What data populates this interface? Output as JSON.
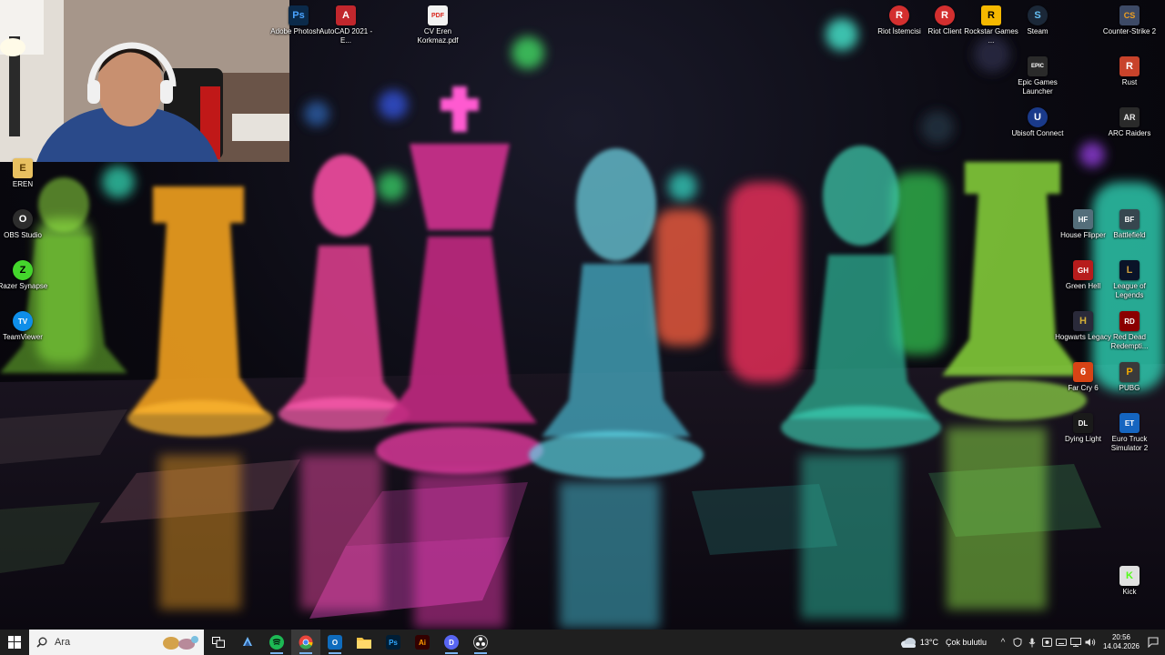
{
  "desktop": {
    "top_icons": [
      {
        "label": "Adobe Photosh...",
        "glyph": "Ps",
        "color": "#0b2a4a",
        "fg": "#4aa3ff"
      },
      {
        "label": "AutoCAD 2021 - E...",
        "glyph": "A",
        "color": "#c1272d",
        "fg": "#ffffff"
      },
      {
        "label": "CV Eren Korkmaz.pdf",
        "glyph": "PDF",
        "color": "#f2f2f2",
        "fg": "#d9261c"
      }
    ],
    "right_col1": [
      {
        "label": "Riot İstemcisi",
        "glyph": "R",
        "color": "#d32f2f",
        "fg": "#ffffff"
      },
      {
        "label": "Riot Client",
        "glyph": "R",
        "color": "#d32f2f",
        "fg": "#ffffff"
      },
      {
        "label": "Rockstar Games ...",
        "glyph": "R",
        "color": "#f5b800",
        "fg": "#000000"
      },
      {
        "label": "Steam",
        "glyph": "S",
        "color": "#1b2838",
        "fg": "#66c0f4"
      }
    ],
    "right_col2_top": [
      {
        "label": "Counter-Strike 2",
        "glyph": "CS",
        "color": "#3d4a66",
        "fg": "#f0a020"
      },
      {
        "label": "Rust",
        "glyph": "R",
        "color": "#c8432b",
        "fg": "#ffffff"
      },
      {
        "label": "ARC Raiders",
        "glyph": "AR",
        "color": "#2a2a2a",
        "fg": "#e8e8e8"
      }
    ],
    "steam_col": [
      {
        "label": "Epic Games Launcher",
        "glyph": "EPIC",
        "color": "#2a2a2a",
        "fg": "#ffffff"
      },
      {
        "label": "Ubisoft Connect",
        "glyph": "U",
        "color": "#1a3a8a",
        "fg": "#ffffff"
      }
    ],
    "left_icons": [
      {
        "label": "EREN",
        "glyph": "E",
        "color": "#e8c060",
        "fg": "#5a3a00"
      },
      {
        "label": "OBS Studio",
        "glyph": "O",
        "color": "#2d2d2d",
        "fg": "#ffffff"
      },
      {
        "label": "Razer Synapse",
        "glyph": "Z",
        "color": "#44d62c",
        "fg": "#000000"
      },
      {
        "label": "TeamViewer",
        "glyph": "TV",
        "color": "#0e8ee9",
        "fg": "#ffffff"
      }
    ],
    "games_col1": [
      {
        "label": "House Flipper",
        "glyph": "HF",
        "color": "#546e7a",
        "fg": "#ffffff"
      },
      {
        "label": "Green Hell",
        "glyph": "GH",
        "color": "#b71c1c",
        "fg": "#ffffff"
      },
      {
        "label": "Hogwarts Legacy",
        "glyph": "H",
        "color": "#2a2a3a",
        "fg": "#d4af37"
      },
      {
        "label": "Far Cry 6",
        "glyph": "6",
        "color": "#d84315",
        "fg": "#ffffff"
      },
      {
        "label": "Dying Light",
        "glyph": "DL",
        "color": "#1a1a1a",
        "fg": "#ffffff"
      }
    ],
    "games_col2": [
      {
        "label": "Battlefield",
        "glyph": "BF",
        "color": "#37474f",
        "fg": "#ffffff"
      },
      {
        "label": "League of Legends",
        "glyph": "L",
        "color": "#0a1428",
        "fg": "#c89b3c"
      },
      {
        "label": "Red Dead Redempti...",
        "glyph": "RD",
        "color": "#8b0000",
        "fg": "#ffffff"
      },
      {
        "label": "PUBG",
        "glyph": "P",
        "color": "#3a3a3a",
        "fg": "#f2a900"
      },
      {
        "label": "Euro Truck Simulator 2",
        "glyph": "ET",
        "color": "#1565c0",
        "fg": "#ffffff"
      }
    ],
    "kick": {
      "label": "Kick",
      "glyph": "K",
      "color": "#e0e0e0",
      "fg": "#53fc18"
    }
  },
  "taskbar": {
    "search_placeholder": "Ara",
    "pinned": [
      {
        "name": "task-view",
        "glyph": "▣",
        "color": "transparent",
        "fg": "#ffffff"
      },
      {
        "name": "copilot",
        "glyph": "◆",
        "color": "transparent",
        "fg": "#6fb8ff"
      },
      {
        "name": "spotify",
        "glyph": "♫",
        "color": "#1db954",
        "fg": "#000000"
      },
      {
        "name": "chrome",
        "glyph": "●",
        "color": "transparent",
        "fg": "#e8453c"
      },
      {
        "name": "outlook",
        "glyph": "O",
        "color": "#0f6cbd",
        "fg": "#ffffff"
      },
      {
        "name": "file-explorer",
        "glyph": "▬",
        "color": "transparent",
        "fg": "#f6c445"
      },
      {
        "name": "photoshop",
        "glyph": "Ps",
        "color": "#001e36",
        "fg": "#31a8ff"
      },
      {
        "name": "illustrator",
        "glyph": "Ai",
        "color": "#330000",
        "fg": "#ff9a00"
      },
      {
        "name": "discord",
        "glyph": "D",
        "color": "#5865f2",
        "fg": "#ffffff"
      },
      {
        "name": "obs",
        "glyph": "●",
        "color": "#2d2d2d",
        "fg": "#ffffff"
      }
    ],
    "weather": {
      "temp": "13°C",
      "desc": "Çok bulutlu"
    },
    "clock": {
      "time": "20:56",
      "date": "14.04.2026"
    }
  }
}
